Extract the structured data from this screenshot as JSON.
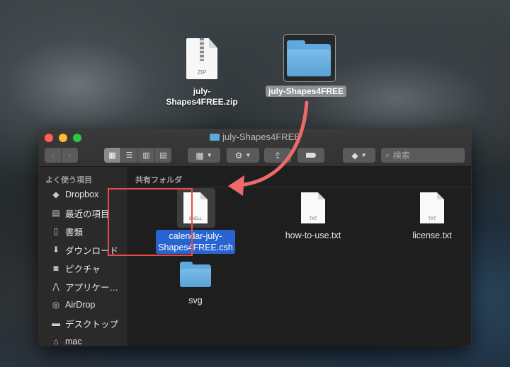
{
  "desktop": {
    "zip_file": {
      "icon_tag": "ZIP",
      "label_line1": "july-",
      "label_line2": "Shapes4FREE.zip"
    },
    "folder": {
      "label": "july-Shapes4FREE"
    }
  },
  "window": {
    "title": "july-Shapes4FREE",
    "search_placeholder": "検索"
  },
  "sidebar": {
    "heading": "よく使う項目",
    "items": [
      {
        "label": "Dropbox",
        "icon": "dropbox-icon"
      },
      {
        "label": "最近の項目",
        "icon": "recents-icon"
      },
      {
        "label": "書類",
        "icon": "documents-icon"
      },
      {
        "label": "ダウンロード",
        "icon": "downloads-icon"
      },
      {
        "label": "ピクチャ",
        "icon": "camera-icon"
      },
      {
        "label": "アプリケー…",
        "icon": "applications-icon"
      },
      {
        "label": "AirDrop",
        "icon": "airdrop-icon"
      },
      {
        "label": "デスクトップ",
        "icon": "desktop-icon"
      },
      {
        "label": "mac",
        "icon": "home-icon"
      }
    ]
  },
  "content": {
    "section": "共有フォルダ",
    "files": [
      {
        "tag": "SHELL",
        "label_line1": "calendar-july-",
        "label_line2": "Shapes4FREE.csh",
        "selected": true
      },
      {
        "tag": "TXT",
        "label": "how-to-use.txt"
      },
      {
        "tag": "TXT",
        "label": "license.txt"
      },
      {
        "type": "folder",
        "label": "svg"
      }
    ]
  },
  "colors": {
    "selection": "#2764d2",
    "highlight_frame": "#ea4a4a",
    "arrow": "#ee6a6a",
    "folder": "#5fa9dc"
  }
}
